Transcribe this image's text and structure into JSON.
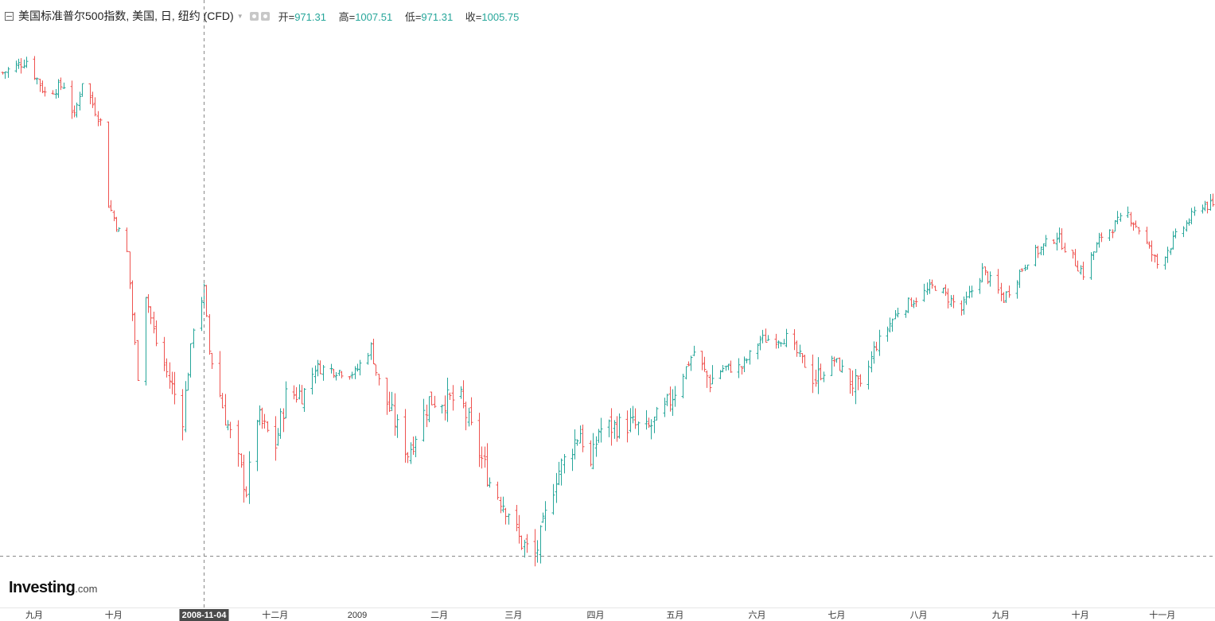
{
  "header": {
    "title": "美国标准普尔500指数, 美国, 日, 纽约 (CFD)",
    "open_label": "开=",
    "open_value": "971.31",
    "high_label": "高=",
    "high_value": "1007.51",
    "low_label": "低=",
    "low_value": "971.31",
    "close_label": "收=",
    "close_value": "1005.75"
  },
  "logo": {
    "brand": "Investing",
    "domain": ".com"
  },
  "colors": {
    "up": "#26a69a",
    "down": "#ef5350",
    "crosshair": "#888888",
    "axis_highlight_bg": "#4a4a4a"
  },
  "crosshair": {
    "x_label": "2008-11-04",
    "y_price": 680
  },
  "chart_data": {
    "type": "ohlc",
    "title": "美国标准普尔500指数, 美国, 日, 纽约 (CFD)",
    "xlabel": "",
    "ylabel": "",
    "ylim": [
      640,
      1320
    ],
    "x_tick_labels": [
      {
        "label": "九月",
        "date": "2008-09-01"
      },
      {
        "label": "十月",
        "date": "2008-10-01"
      },
      {
        "label": "十二月",
        "date": "2008-12-01"
      },
      {
        "label": "2009",
        "date": "2009-01-01"
      },
      {
        "label": "二月",
        "date": "2009-02-01"
      },
      {
        "label": "三月",
        "date": "2009-03-01"
      },
      {
        "label": "四月",
        "date": "2009-04-01"
      },
      {
        "label": "五月",
        "date": "2009-05-01"
      },
      {
        "label": "六月",
        "date": "2009-06-01"
      },
      {
        "label": "七月",
        "date": "2009-07-01"
      },
      {
        "label": "八月",
        "date": "2009-08-01"
      },
      {
        "label": "九月",
        "date": "2009-09-01"
      },
      {
        "label": "十月",
        "date": "2009-10-01"
      },
      {
        "label": "十一月",
        "date": "2009-11-01"
      }
    ],
    "start_date": "2008-08-20",
    "end_date": "2009-11-20",
    "anchors": [
      [
        "2008-08-20",
        1270
      ],
      [
        "2008-08-29",
        1285
      ],
      [
        "2008-09-05",
        1245
      ],
      [
        "2008-09-12",
        1255
      ],
      [
        "2008-09-16",
        1215
      ],
      [
        "2008-09-19",
        1260
      ],
      [
        "2008-09-26",
        1210
      ],
      [
        "2008-09-29",
        1110
      ],
      [
        "2008-10-06",
        1050
      ],
      [
        "2008-10-10",
        900
      ],
      [
        "2008-10-13",
        1000
      ],
      [
        "2008-10-17",
        940
      ],
      [
        "2008-10-27",
        850
      ],
      [
        "2008-10-31",
        960
      ],
      [
        "2008-11-04",
        1005
      ],
      [
        "2008-11-06",
        930
      ],
      [
        "2008-11-12",
        850
      ],
      [
        "2008-11-20",
        760
      ],
      [
        "2008-11-24",
        850
      ],
      [
        "2008-12-01",
        815
      ],
      [
        "2008-12-05",
        875
      ],
      [
        "2008-12-12",
        880
      ],
      [
        "2008-12-16",
        910
      ],
      [
        "2008-12-31",
        903
      ],
      [
        "2009-01-06",
        935
      ],
      [
        "2009-01-09",
        890
      ],
      [
        "2009-01-20",
        805
      ],
      [
        "2009-01-28",
        870
      ],
      [
        "2009-02-09",
        870
      ],
      [
        "2009-02-20",
        770
      ],
      [
        "2009-02-27",
        735
      ],
      [
        "2009-03-03",
        700
      ],
      [
        "2009-03-09",
        677
      ],
      [
        "2009-03-17",
        778
      ],
      [
        "2009-03-26",
        832
      ],
      [
        "2009-03-30",
        787
      ],
      [
        "2009-04-02",
        834
      ],
      [
        "2009-04-14",
        841
      ],
      [
        "2009-04-20",
        832
      ],
      [
        "2009-04-27",
        857
      ],
      [
        "2009-05-08",
        929
      ],
      [
        "2009-05-14",
        893
      ],
      [
        "2009-05-19",
        909
      ],
      [
        "2009-05-26",
        910
      ],
      [
        "2009-06-02",
        944
      ],
      [
        "2009-06-12",
        946
      ],
      [
        "2009-06-23",
        895
      ],
      [
        "2009-06-30",
        919
      ],
      [
        "2009-07-10",
        879
      ],
      [
        "2009-07-15",
        932
      ],
      [
        "2009-07-24",
        979
      ],
      [
        "2009-08-07",
        1010
      ],
      [
        "2009-08-17",
        980
      ],
      [
        "2009-08-25",
        1028
      ],
      [
        "2009-09-02",
        994
      ],
      [
        "2009-09-11",
        1042
      ],
      [
        "2009-09-22",
        1071
      ],
      [
        "2009-10-02",
        1025
      ],
      [
        "2009-10-09",
        1071
      ],
      [
        "2009-10-19",
        1097
      ],
      [
        "2009-10-23",
        1079
      ],
      [
        "2009-10-30",
        1036
      ],
      [
        "2009-11-06",
        1069
      ],
      [
        "2009-11-16",
        1110
      ],
      [
        "2009-11-20",
        1106
      ]
    ],
    "last_bar": {
      "open": 971.31,
      "high": 1007.51,
      "low": 971.31,
      "close": 1005.75
    }
  }
}
